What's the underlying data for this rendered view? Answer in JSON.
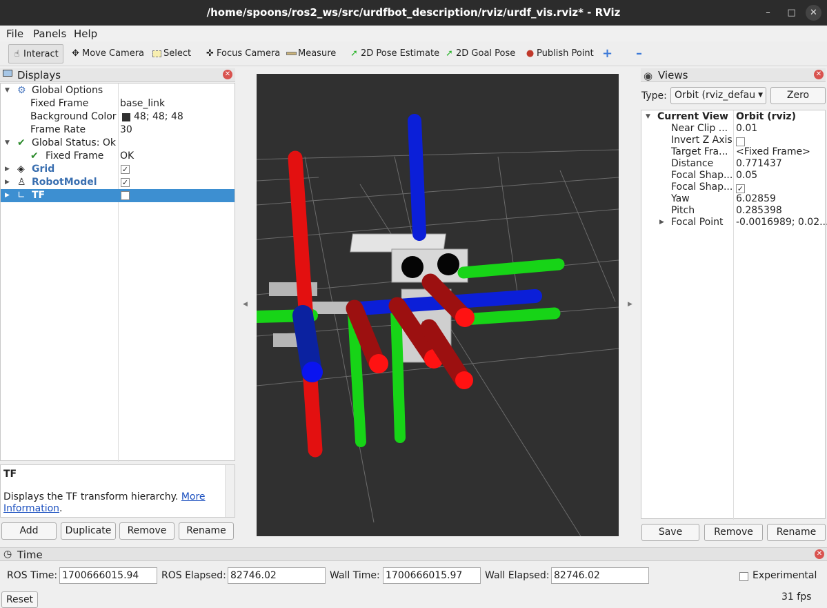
{
  "window": {
    "title": "/home/spoons/ros2_ws/src/urdfbot_description/rviz/urdf_vis.rviz* - RViz"
  },
  "menu": {
    "file": "File",
    "panels": "Panels",
    "help": "Help"
  },
  "toolbar": {
    "interact": "Interact",
    "move_camera": "Move Camera",
    "select": "Select",
    "focus_camera": "Focus Camera",
    "measure": "Measure",
    "pose_estimate": "2D Pose Estimate",
    "goal_pose": "2D Goal Pose",
    "publish_point": "Publish Point"
  },
  "displays": {
    "title": "Displays",
    "rows": {
      "global_options": "Global Options",
      "fixed_frame_label": "Fixed Frame",
      "fixed_frame_value": "base_link",
      "bg_color_label": "Background Color",
      "bg_color_value": "48; 48; 48",
      "frame_rate_label": "Frame Rate",
      "frame_rate_value": "30",
      "global_status": "Global Status: Ok",
      "status_fixed_frame_label": "Fixed Frame",
      "status_fixed_frame_value": "OK",
      "grid": "Grid",
      "robot_model": "RobotModel",
      "tf": "TF"
    },
    "description": {
      "title": "TF",
      "text": "Displays the TF transform hierarchy. ",
      "link_more": "More",
      "link_info": "Information",
      "period": "."
    },
    "buttons": {
      "add": "Add",
      "duplicate": "Duplicate",
      "remove": "Remove",
      "rename": "Rename"
    }
  },
  "views": {
    "title": "Views",
    "type_label": "Type:",
    "type_value": "Orbit (rviz_defau",
    "zero": "Zero",
    "current_view_label": "Current View",
    "current_view_value": "Orbit (rviz)",
    "props": [
      {
        "label": "Near Clip ...",
        "value": "0.01"
      },
      {
        "label": "Invert Z Axis",
        "value": ""
      },
      {
        "label": "Target Fra...",
        "value": "<Fixed Frame>"
      },
      {
        "label": "Distance",
        "value": "0.771437"
      },
      {
        "label": "Focal Shap...",
        "value": "0.05"
      },
      {
        "label": "Focal Shap...",
        "value": ""
      },
      {
        "label": "Yaw",
        "value": "6.02859"
      },
      {
        "label": "Pitch",
        "value": "0.285398"
      },
      {
        "label": "Focal Point",
        "value": "-0.0016989; 0.02..."
      }
    ],
    "buttons": {
      "save": "Save",
      "remove": "Remove",
      "rename": "Rename"
    }
  },
  "time": {
    "title": "Time",
    "ros_time_label": "ROS Time:",
    "ros_time_value": "1700666015.94",
    "ros_elapsed_label": "ROS Elapsed:",
    "ros_elapsed_value": "82746.02",
    "wall_time_label": "Wall Time:",
    "wall_time_value": "1700666015.97",
    "wall_elapsed_label": "Wall Elapsed:",
    "wall_elapsed_value": "82746.02",
    "experimental": "Experimental",
    "reset": "Reset",
    "fps": "31 fps"
  },
  "colors": {
    "background": "#303030",
    "x_axis": "#e01010",
    "y_axis": "#10d010",
    "z_axis": "#0a10e0",
    "selection": "#3d8fd1"
  }
}
